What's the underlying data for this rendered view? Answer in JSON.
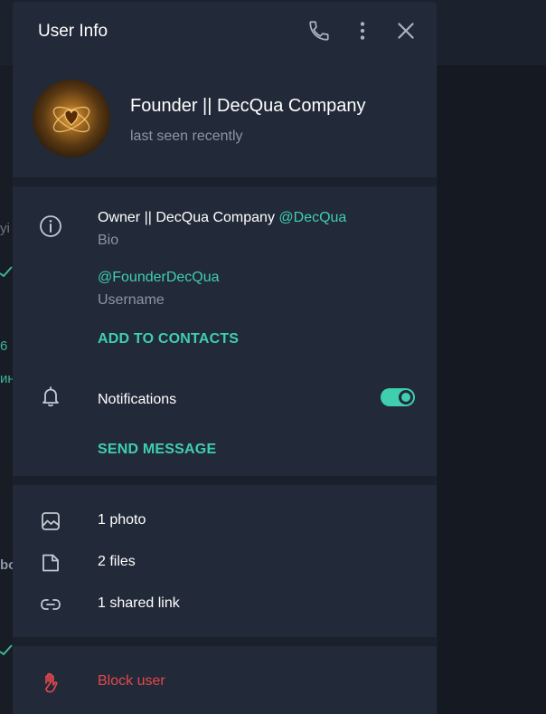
{
  "background": {
    "fragments": [
      "уі",
      "6",
      "ин",
      "bo"
    ]
  },
  "header": {
    "title": "User Info",
    "icons": [
      "phone-icon",
      "more-vertical-icon",
      "close-icon"
    ]
  },
  "profile": {
    "name": "Founder || DecQua Company",
    "status": "last seen recently"
  },
  "info": {
    "bio_text": "Owner || DecQua Company ",
    "bio_mention": "@DecQua",
    "bio_label": "Bio",
    "username": "@FounderDecQua",
    "username_label": "Username",
    "add_contacts": "ADD TO CONTACTS",
    "notifications_label": "Notifications",
    "notifications_enabled": true,
    "send_message": "SEND MESSAGE"
  },
  "media": [
    {
      "icon": "photo-icon",
      "label": "1 photo"
    },
    {
      "icon": "file-icon",
      "label": "2 files"
    },
    {
      "icon": "link-icon",
      "label": "1 shared link"
    }
  ],
  "block": {
    "icon": "hand-icon",
    "label": "Block user"
  },
  "colors": {
    "accent": "#3fcfae",
    "danger": "#e5484d",
    "panel": "#222938",
    "divider": "#1b212c"
  }
}
